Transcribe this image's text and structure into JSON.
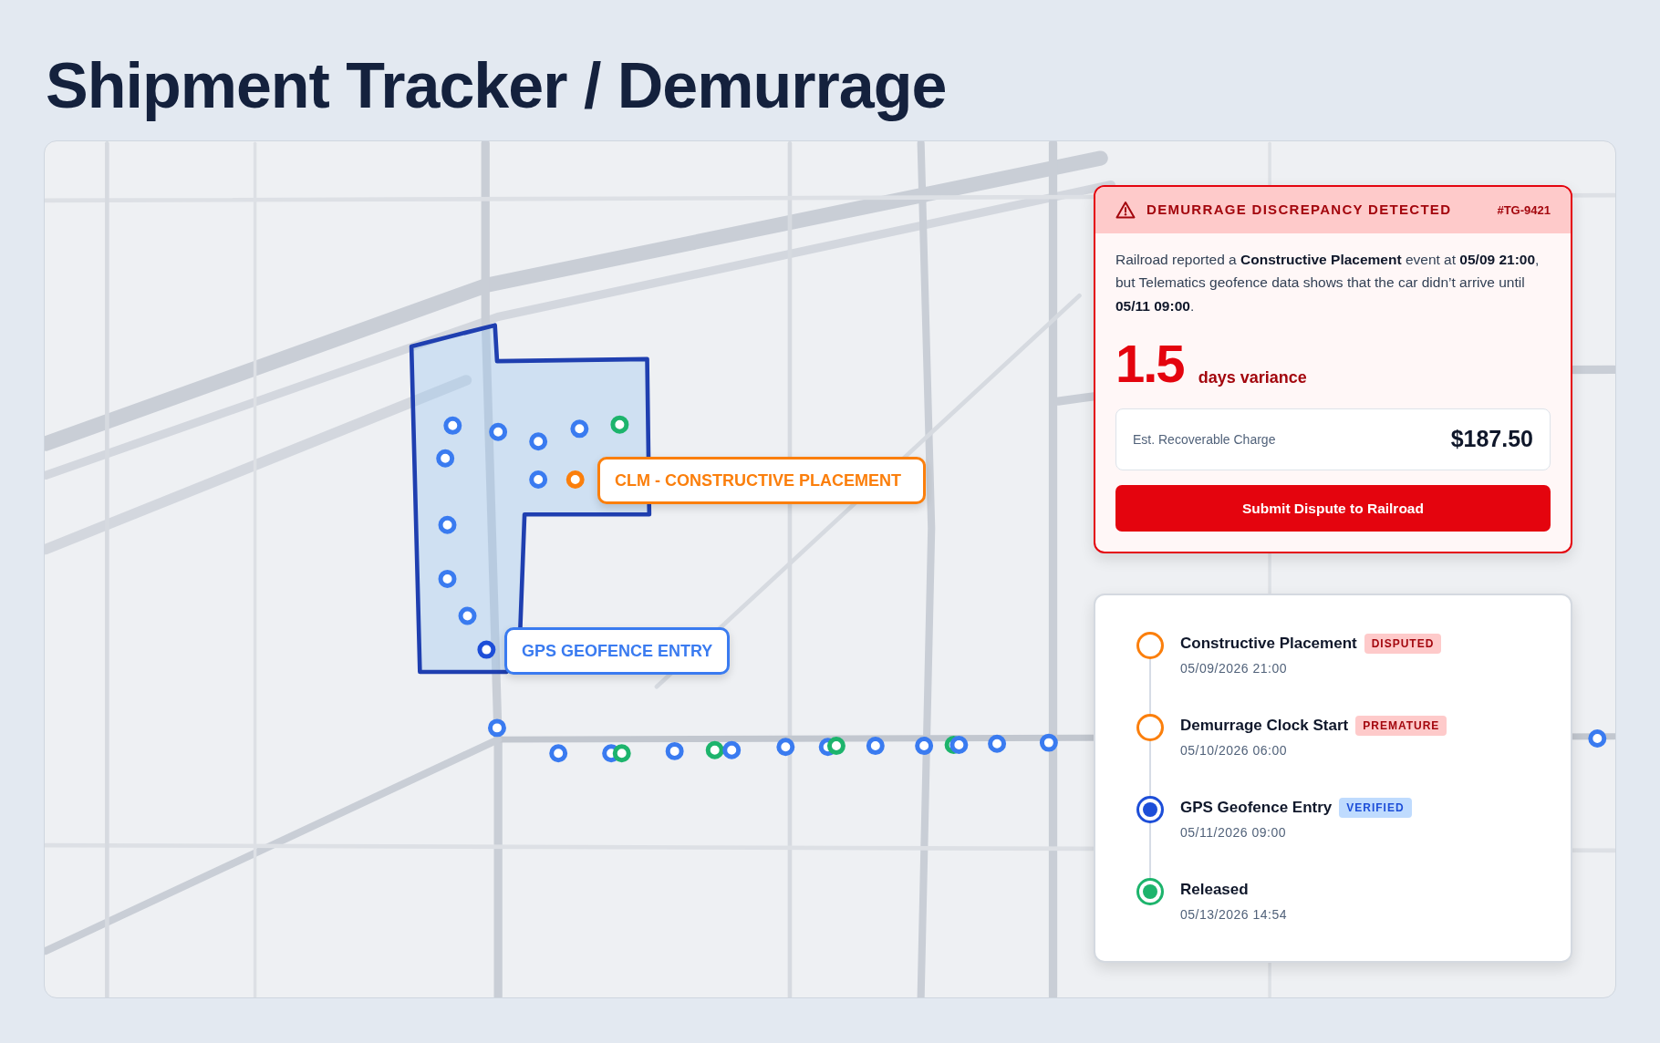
{
  "page_title": "Shipment Tracker / Demurrage",
  "map": {
    "callouts": [
      {
        "text": "CLM  -  CONSTRUCTIVE PLACEMENT",
        "color": "#fb7f0c"
      },
      {
        "text": "GPS GEOFENCE ENTRY",
        "color": "#3a7bf0"
      }
    ],
    "pings": [
      {
        "color": "#3a7bf0"
      },
      {
        "color": "#3a7bf0"
      },
      {
        "color": "#3a7bf0"
      },
      {
        "color": "#3a7bf0"
      },
      {
        "color": "#1db46c"
      },
      {
        "color": "#3a7bf0"
      },
      {
        "color": "#3a7bf0"
      },
      {
        "color": "#fb7f0c"
      },
      {
        "color": "#3a7bf0"
      },
      {
        "color": "#3a7bf0"
      },
      {
        "color": "#3a7bf0"
      },
      {
        "color": "#1d4ed8"
      },
      {
        "color": "#3a7bf0"
      },
      {
        "color": "#3a7bf0"
      },
      {
        "color": "#3a7bf0"
      },
      {
        "color": "#1db46c"
      },
      {
        "color": "#3a7bf0"
      },
      {
        "color": "#1db46c"
      },
      {
        "color": "#3a7bf0"
      },
      {
        "color": "#3a7bf0"
      },
      {
        "color": "#3a7bf0"
      },
      {
        "color": "#1db46c"
      },
      {
        "color": "#3a7bf0"
      },
      {
        "color": "#3a7bf0"
      },
      {
        "color": "#1db46c"
      },
      {
        "color": "#3a7bf0"
      },
      {
        "color": "#3a7bf0"
      },
      {
        "color": "#3a7bf0"
      },
      {
        "color": "#3a7bf0"
      }
    ]
  },
  "alert": {
    "title": "DEMURRAGE DISCREPANCY DETECTED",
    "ticket": "#TG-9421",
    "message": "Railroad reported a **Constructive Placement** event at **05/09 21:00**, but Telematics geofence data shows that the car didn’t arrive until **05/11 09:00**.",
    "variance": "1.5",
    "variance_label": "days variance",
    "charge_label": "Est. Recoverable Charge",
    "charge_value": "$187.50",
    "button": "Submit Dispute to Railroad"
  },
  "timeline": [
    {
      "title": "Constructive Placement",
      "time": "05/09/2026 21:00",
      "badge": "DISPUTED",
      "kind": "hollow",
      "color": "#fb7f0c"
    },
    {
      "title": "Demurrage Clock Start",
      "time": "05/10/2026 06:00",
      "badge": "PREMATURE",
      "kind": "hollow",
      "color": "#fb7f0c"
    },
    {
      "title": "GPS Geofence Entry",
      "time": "05/11/2026 09:00",
      "badge": "VERIFIED",
      "kind": "filled",
      "color": "#1d4ed8"
    },
    {
      "title": "Released",
      "time": "05/13/2026 14:54",
      "kind": "filled",
      "color": "#1db46c"
    }
  ]
}
